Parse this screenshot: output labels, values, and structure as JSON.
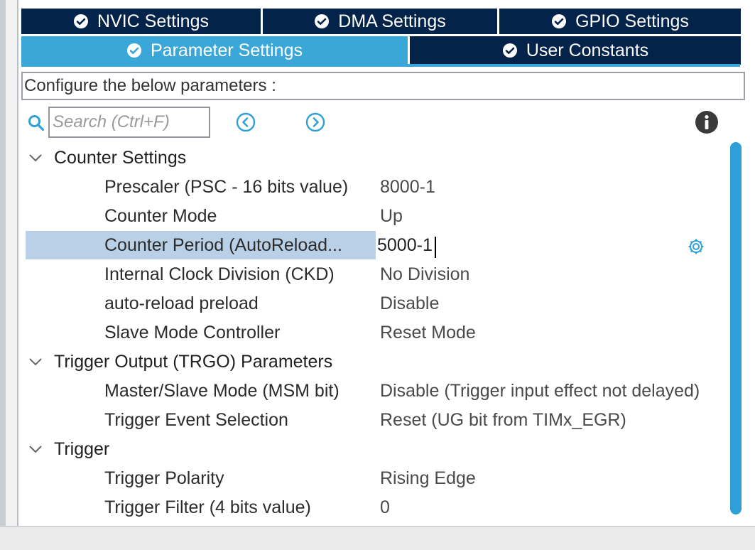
{
  "tabs_top": [
    {
      "label": "NVIC Settings"
    },
    {
      "label": "DMA Settings"
    },
    {
      "label": "GPIO Settings"
    }
  ],
  "tabs_bottom": [
    {
      "label": "Parameter Settings",
      "active": true
    },
    {
      "label": "User Constants"
    }
  ],
  "hint": "Configure the below parameters :",
  "search": {
    "placeholder": "Search (Ctrl+F)",
    "value": ""
  },
  "groups": [
    {
      "label": "Counter Settings",
      "params": [
        {
          "name": "Prescaler (PSC - 16 bits value)",
          "value": "8000-1"
        },
        {
          "name": "Counter Mode",
          "value": "Up"
        },
        {
          "name": "Counter Period (AutoReload...",
          "value": "5000-1",
          "selected": true
        },
        {
          "name": "Internal Clock Division (CKD)",
          "value": "No Division"
        },
        {
          "name": "auto-reload preload",
          "value": "Disable"
        },
        {
          "name": "Slave Mode Controller",
          "value": "Reset Mode"
        }
      ]
    },
    {
      "label": "Trigger Output (TRGO) Parameters",
      "params": [
        {
          "name": "Master/Slave Mode (MSM bit)",
          "value": "Disable (Trigger input effect not delayed)"
        },
        {
          "name": "Trigger Event Selection",
          "value": "Reset (UG bit from TIMx_EGR)"
        }
      ]
    },
    {
      "label": "Trigger",
      "params": [
        {
          "name": "Trigger Polarity",
          "value": "Rising Edge"
        },
        {
          "name": "Trigger Filter (4 bits value)",
          "value": "0"
        }
      ]
    }
  ],
  "icons": {
    "tab_check": "check-circle-icon",
    "search": "search-icon",
    "prev": "chevron-left-circle-icon",
    "next": "chevron-right-circle-icon",
    "info": "info-icon",
    "expand": "chevron-down-icon",
    "settings": "gear-icon"
  },
  "colors": {
    "tab_dark": "#03234b",
    "tab_active": "#3aa7d9",
    "selection": "#b9d0e6",
    "accent": "#2f9fd8"
  }
}
